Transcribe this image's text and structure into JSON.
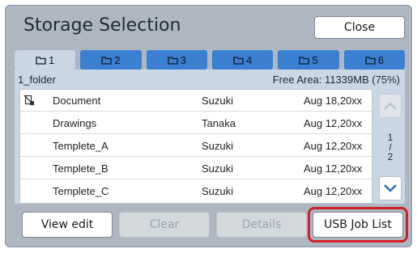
{
  "title": "Storage Selection",
  "close_label": "Close",
  "tabs": [
    {
      "label": "1",
      "active": true
    },
    {
      "label": "2",
      "active": false
    },
    {
      "label": "3",
      "active": false
    },
    {
      "label": "4",
      "active": false
    },
    {
      "label": "5",
      "active": false
    },
    {
      "label": "6",
      "active": false
    }
  ],
  "folder": {
    "name": "1_folder",
    "free_area": "Free Area: 11339MB (75%)"
  },
  "rows": [
    {
      "icon": "locked-document-icon",
      "name": "Document",
      "owner": "Suzuki",
      "date": "Aug 18,20xx"
    },
    {
      "icon": "",
      "name": "Drawings",
      "owner": "Tanaka",
      "date": "Aug 12,20xx"
    },
    {
      "icon": "",
      "name": "Templete_A",
      "owner": "Suzuki",
      "date": "Aug 12,20xx"
    },
    {
      "icon": "",
      "name": "Templete_B",
      "owner": "Suzuki",
      "date": "Aug 12,20xx"
    },
    {
      "icon": "",
      "name": "Templete_C",
      "owner": "Suzuki",
      "date": "Aug 12,20xx"
    }
  ],
  "pagination": {
    "current": "1",
    "separator": "/",
    "total": "2"
  },
  "buttons": {
    "view_edit": "View edit",
    "clear": "Clear",
    "details": "Details",
    "usb_job_list": "USB Job List"
  },
  "colors": {
    "tab_blue": "#3a7fd0",
    "panel_bg": "#c9d6e3",
    "frame_bg": "#aeb7c1",
    "highlight_red": "#d0202a"
  }
}
